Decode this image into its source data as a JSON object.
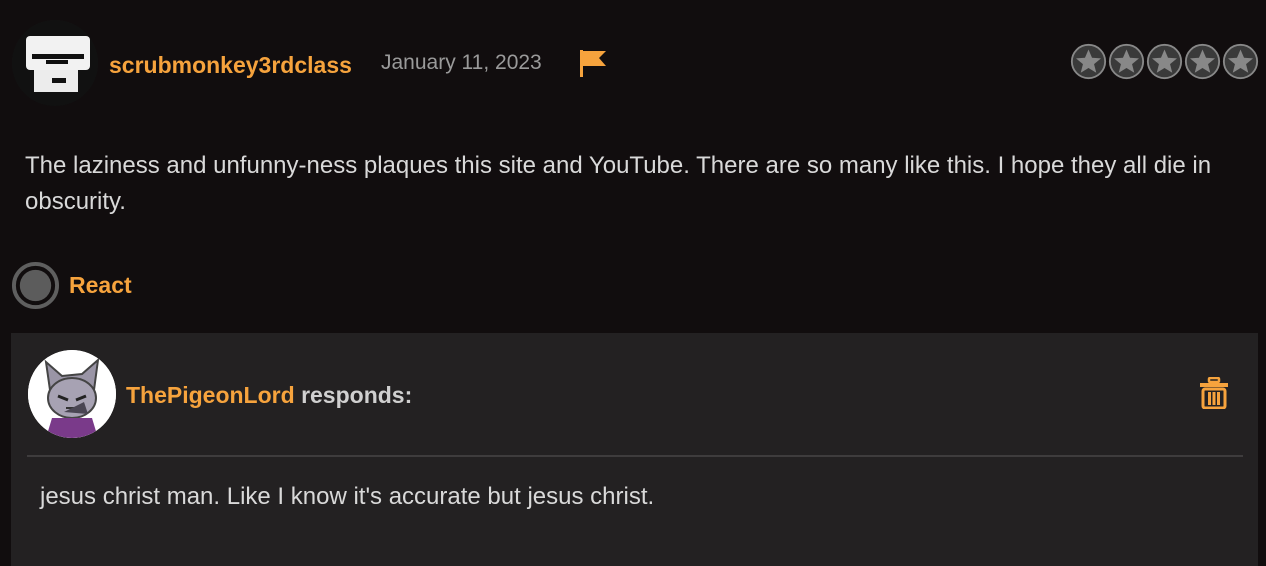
{
  "comment": {
    "username": "scrubmonkey3rdclass",
    "date": "January 11, 2023",
    "avatar_icon": "masked-face-avatar-icon",
    "flag_icon": "flag-icon",
    "rating": {
      "value": 0,
      "max": 5,
      "icon": "star-icon"
    },
    "text": "The laziness and unfunny-ness plaques this site and YouTube. There are so many like this. I hope they all die in obscurity.",
    "react_label": "React"
  },
  "response": {
    "username": "ThePigeonLord",
    "verb": "responds:",
    "avatar_icon": "cat-character-avatar-icon",
    "delete_icon": "trash-icon",
    "text": "jesus christ man. Like I know it's accurate but jesus christ."
  },
  "colors": {
    "accent": "#f6a33d",
    "background": "#110d0e",
    "panel": "#232122",
    "text": "#d9d9d9"
  }
}
